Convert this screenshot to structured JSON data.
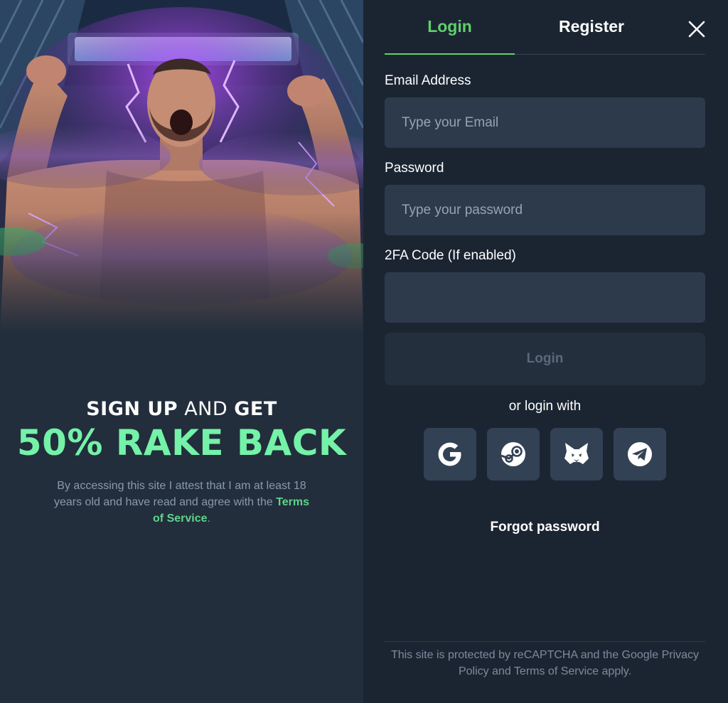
{
  "promo": {
    "heading_bold_1": "SIGN UP",
    "heading_light": "AND",
    "heading_bold_2": "GET",
    "offer": "50% RAKE BACK",
    "legal_prefix": "By accessing this site I attest that I am at least 18 years old and have read and agree with the",
    "legal_link": "Terms of Service",
    "legal_suffix": "."
  },
  "tabs": {
    "login": "Login",
    "register": "Register",
    "active": "login"
  },
  "form": {
    "email_label": "Email Address",
    "email_placeholder": "Type your Email",
    "password_label": "Password",
    "password_placeholder": "Type your password",
    "twofa_label": "2FA Code (If enabled)",
    "twofa_placeholder": "",
    "submit_label": "Login"
  },
  "social": {
    "heading": "or login with",
    "providers": [
      {
        "name": "Google",
        "icon": "google-icon"
      },
      {
        "name": "Steam",
        "icon": "steam-icon"
      },
      {
        "name": "MetaMask",
        "icon": "metamask-icon"
      },
      {
        "name": "Telegram",
        "icon": "telegram-icon"
      }
    ]
  },
  "forgot_password": "Forgot password",
  "recaptcha_notice": "This site is protected by reCAPTCHA and the Google Privacy Policy and Terms of Service apply.",
  "colors": {
    "accent": "#5fd06d",
    "offer": "#74f2a8",
    "panel_bg": "#1b2532",
    "promo_bg": "#222e3c",
    "field_bg": "#2d3a4c",
    "social_bg": "#334155"
  }
}
